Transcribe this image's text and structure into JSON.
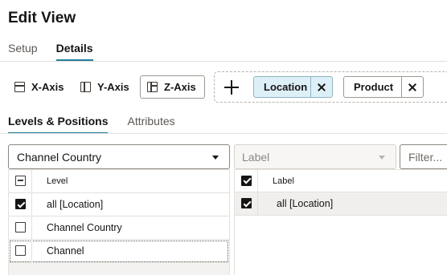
{
  "header": {
    "title": "Edit View"
  },
  "main_tabs": [
    {
      "label": "Setup",
      "active": false
    },
    {
      "label": "Details",
      "active": true
    }
  ],
  "axis_buttons": [
    {
      "label": "X-Axis",
      "icon": "x-axis-icon"
    },
    {
      "label": "Y-Axis",
      "icon": "y-axis-icon"
    },
    {
      "label": "Z-Axis",
      "icon": "z-axis-icon",
      "selected": true
    }
  ],
  "drop_zone": {
    "add_icon": "plus-icon",
    "chips": [
      {
        "label": "Location",
        "selected": true
      },
      {
        "label": "Product",
        "selected": false
      }
    ]
  },
  "sub_tabs": [
    {
      "label": "Levels & Positions",
      "active": true
    },
    {
      "label": "Attributes",
      "active": false
    }
  ],
  "levels_select": {
    "value": "Channel Country"
  },
  "label_select": {
    "placeholder": "Label"
  },
  "filter_input": {
    "placeholder": "Filter..."
  },
  "levels_grid": {
    "header": "Level",
    "rows": [
      {
        "label": "all [Location]",
        "checked": true
      },
      {
        "label": "Channel Country",
        "checked": false
      },
      {
        "label": "Channel",
        "checked": false
      }
    ]
  },
  "positions_grid": {
    "header": "Label",
    "rows": [
      {
        "label": "all [Location]",
        "checked": true
      }
    ]
  },
  "colors": {
    "accent": "#227e9e",
    "chip_selected_bg": "#def0f7"
  }
}
